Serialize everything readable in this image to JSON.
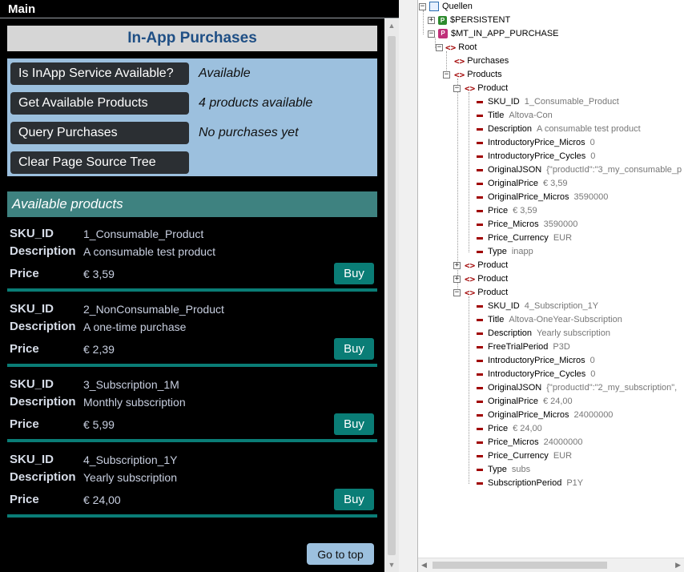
{
  "window": {
    "title": "Main"
  },
  "header": {
    "title": "In-App Purchases"
  },
  "service": {
    "rows": [
      {
        "button": "Is InApp Service Available?",
        "status": "Available"
      },
      {
        "button": "Get Available Products",
        "status": "4 products available"
      },
      {
        "button": "Query Purchases",
        "status": "No purchases yet"
      },
      {
        "button": "Clear Page Source Tree",
        "status": ""
      }
    ]
  },
  "products_section": {
    "title": "Available products"
  },
  "labels": {
    "sku": "SKU_ID",
    "description": "Description",
    "price": "Price",
    "buy": "Buy"
  },
  "products": [
    {
      "sku": "1_Consumable_Product",
      "description": "A consumable test product",
      "price": "€ 3,59"
    },
    {
      "sku": "2_NonConsumable_Product",
      "description": "A one-time purchase",
      "price": "€ 2,39"
    },
    {
      "sku": "3_Subscription_1M",
      "description": "Monthly subscription",
      "price": "€ 5,99"
    },
    {
      "sku": "4_Subscription_1Y",
      "description": "Yearly subscription",
      "price": "€ 24,00"
    }
  ],
  "goto_top": "Go to top",
  "tree": {
    "root": "Quellen",
    "persistent": "$PERSISTENT",
    "mt": "$MT_IN_APP_PURCHASE",
    "root_el": "Root",
    "purchases": "Purchases",
    "products": "Products",
    "product": "Product",
    "product1": [
      {
        "name": "SKU_ID",
        "value": "1_Consumable_Product"
      },
      {
        "name": "Title",
        "value": "Altova-Con"
      },
      {
        "name": "Description",
        "value": "A consumable test product"
      },
      {
        "name": "IntroductoryPrice_Micros",
        "value": "0"
      },
      {
        "name": "IntroductoryPrice_Cycles",
        "value": "0"
      },
      {
        "name": "OriginalJSON",
        "value": "{\"productId\":\"3_my_consumable_p"
      },
      {
        "name": "OriginalPrice",
        "value": "€ 3,59"
      },
      {
        "name": "OriginalPrice_Micros",
        "value": "3590000"
      },
      {
        "name": "Price",
        "value": "€ 3,59"
      },
      {
        "name": "Price_Micros",
        "value": "3590000"
      },
      {
        "name": "Price_Currency",
        "value": "EUR"
      },
      {
        "name": "Type",
        "value": "inapp"
      }
    ],
    "product4": [
      {
        "name": "SKU_ID",
        "value": "4_Subscription_1Y"
      },
      {
        "name": "Title",
        "value": "Altova-OneYear-Subscription"
      },
      {
        "name": "Description",
        "value": "Yearly subscription"
      },
      {
        "name": "FreeTrialPeriod",
        "value": "P3D"
      },
      {
        "name": "IntroductoryPrice_Micros",
        "value": "0"
      },
      {
        "name": "IntroductoryPrice_Cycles",
        "value": "0"
      },
      {
        "name": "OriginalJSON",
        "value": "{\"productId\":\"2_my_subscription\","
      },
      {
        "name": "OriginalPrice",
        "value": "€ 24,00"
      },
      {
        "name": "OriginalPrice_Micros",
        "value": "24000000"
      },
      {
        "name": "Price",
        "value": "€ 24,00"
      },
      {
        "name": "Price_Micros",
        "value": "24000000"
      },
      {
        "name": "Price_Currency",
        "value": "EUR"
      },
      {
        "name": "Type",
        "value": "subs"
      },
      {
        "name": "SubscriptionPeriod",
        "value": "P1Y"
      }
    ]
  },
  "icons": {
    "collapse": "minus-toggle-icon",
    "expand": "plus-toggle-icon",
    "element": "xml-element-icon",
    "attribute": "xml-attribute-icon"
  },
  "colors": {
    "button_dark": "#2b2f33",
    "panel_blue": "#9cc0de",
    "teal": "#0a7d76",
    "header_text": "#1f4f85",
    "tag_red": "#a00000"
  }
}
